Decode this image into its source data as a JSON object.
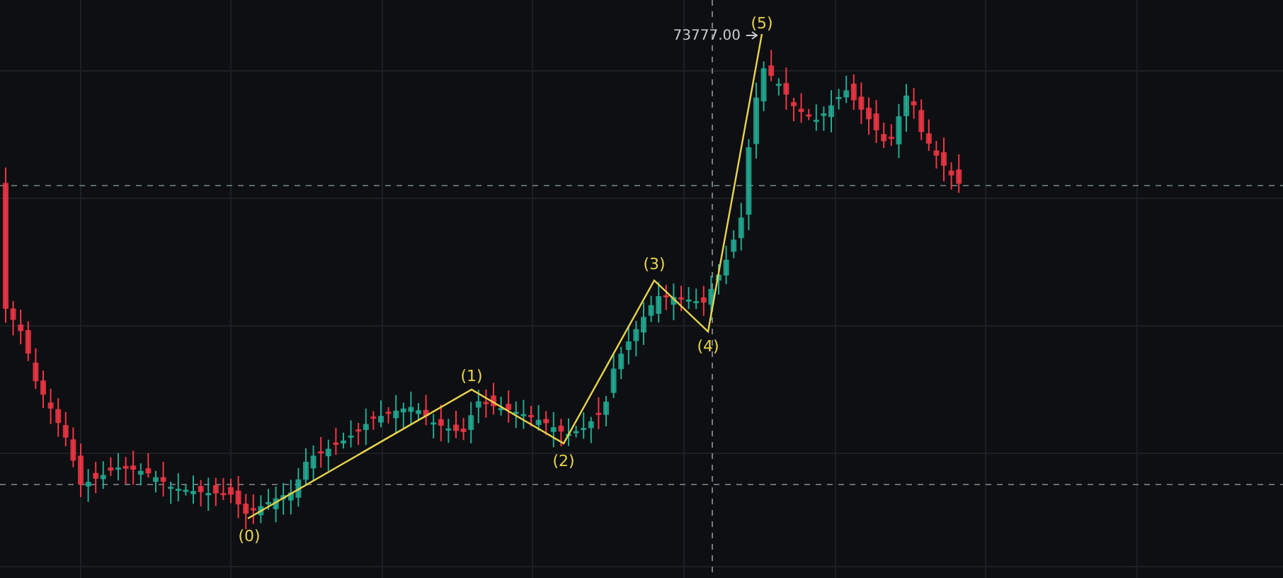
{
  "chart": {
    "price_label": "73777.00",
    "wave_labels": [
      "(0)",
      "(1)",
      "(2)",
      "(3)",
      "(4)",
      "(5)"
    ]
  }
}
